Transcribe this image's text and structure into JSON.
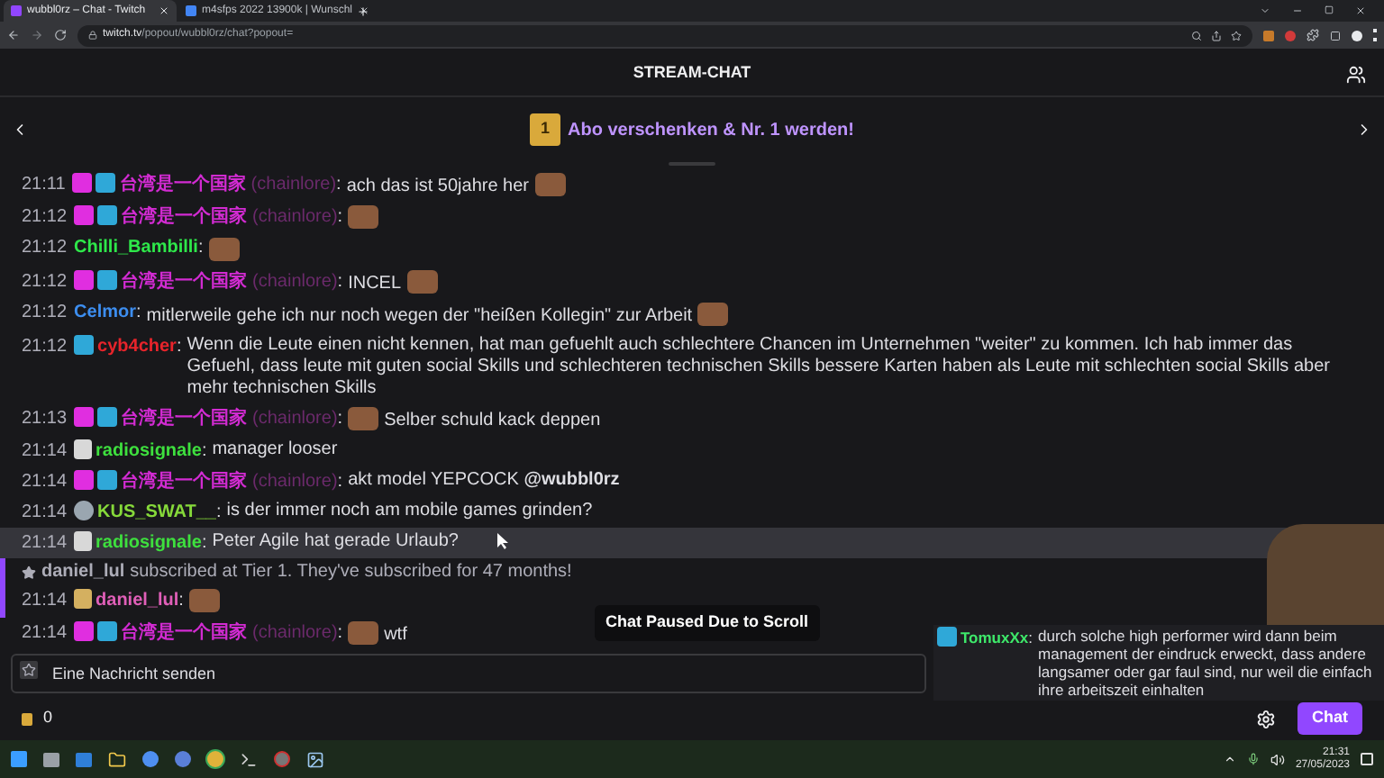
{
  "browser": {
    "tabs": [
      {
        "title": "wubbl0rz – Chat - Twitch",
        "selected": true
      },
      {
        "title": "m4sfps 2022 13900k | Wunschl",
        "selected": false
      }
    ],
    "url_host": "twitch.tv",
    "url_path": "/popout/wubbl0rz/chat?popout="
  },
  "header": {
    "title": "STREAM-CHAT"
  },
  "banner": {
    "text": "Abo verschenken & Nr. 1 werden!",
    "badge": "1"
  },
  "messages": [
    {
      "kind": "chat",
      "time": "21:11",
      "badges": [
        {
          "kind": "gem"
        },
        {
          "kind": "crown"
        }
      ],
      "user": "台湾是一个国家",
      "login": "(chainlore)",
      "separator": ":",
      "color": "#d22bd2",
      "hovered": false,
      "parts": [
        {
          "kind": "text",
          "text": "ach das ist 50jahre her"
        },
        {
          "kind": "emote"
        }
      ]
    },
    {
      "kind": "chat",
      "time": "21:12",
      "badges": [
        {
          "kind": "gem"
        },
        {
          "kind": "crown"
        }
      ],
      "user": "台湾是一个国家",
      "login": "(chainlore)",
      "separator": ":",
      "color": "#d22bd2",
      "hovered": false,
      "parts": [
        {
          "kind": "emote"
        }
      ]
    },
    {
      "kind": "chat",
      "time": "21:12",
      "user": "Chilli_Bambilli",
      "separator": ":",
      "color": "#2ee84a",
      "hovered": false,
      "parts": [
        {
          "kind": "emote"
        }
      ]
    },
    {
      "kind": "chat",
      "time": "21:12",
      "badges": [
        {
          "kind": "gem"
        },
        {
          "kind": "crown"
        }
      ],
      "user": "台湾是一个国家",
      "login": "(chainlore)",
      "separator": ":",
      "color": "#d22bd2",
      "hovered": false,
      "parts": [
        {
          "kind": "text",
          "text": "INCEL"
        },
        {
          "kind": "emote"
        }
      ]
    },
    {
      "kind": "chat",
      "time": "21:12",
      "user": "Celmor",
      "separator": ":",
      "color": "#3d8ef0",
      "hovered": false,
      "parts": [
        {
          "kind": "text",
          "text": "mitlerweile gehe ich nur noch wegen der \"heißen Kollegin\" zur Arbeit"
        },
        {
          "kind": "emote"
        }
      ]
    },
    {
      "kind": "chat",
      "time": "21:12",
      "badges": [
        {
          "kind": "crown"
        }
      ],
      "user": "cyb4cher",
      "separator": ":",
      "color": "#e8242b",
      "hovered": false,
      "parts": [
        {
          "kind": "text",
          "text": "Wenn die Leute einen nicht kennen, hat man gefuehlt auch schlechtere Chancen im Unternehmen \"weiter\" zu kommen. Ich hab immer das Gefuehl, dass leute mit guten social Skills und schlechteren technischen Skills bessere Karten haben als Leute mit schlechten social Skills aber mehr technischen Skills"
        }
      ]
    },
    {
      "kind": "chat",
      "time": "21:13",
      "badges": [
        {
          "kind": "gem"
        },
        {
          "kind": "crown"
        }
      ],
      "user": "台湾是一个国家",
      "login": "(chainlore)",
      "separator": ":",
      "color": "#d22bd2",
      "hovered": false,
      "parts": [
        {
          "kind": "emote"
        },
        {
          "kind": "text",
          "text": "Selber schuld kack deppen"
        }
      ]
    },
    {
      "kind": "chat",
      "time": "21:14",
      "badges": [
        {
          "kind": "avatar"
        }
      ],
      "user": "radiosignale",
      "separator": ":",
      "color": "#3ee03e",
      "hovered": false,
      "parts": [
        {
          "kind": "text",
          "text": "manager looser"
        }
      ]
    },
    {
      "kind": "chat",
      "time": "21:14",
      "badges": [
        {
          "kind": "gem"
        },
        {
          "kind": "crown"
        }
      ],
      "user": "台湾是一个国家",
      "login": "(chainlore)",
      "separator": ":",
      "color": "#d22bd2",
      "hovered": false,
      "parts": [
        {
          "kind": "text",
          "text": "akt model YEPCOCK **@wubbl0rz**"
        }
      ]
    },
    {
      "kind": "chat",
      "time": "21:14",
      "badges": [
        {
          "kind": "globe"
        }
      ],
      "user": "KUS_SWAT__",
      "separator": ":",
      "color": "#86d93a",
      "hovered": false,
      "parts": [
        {
          "kind": "text",
          "text": "is der immer noch am mobile games grinden?"
        }
      ]
    },
    {
      "kind": "chat",
      "time": "21:14",
      "badges": [
        {
          "kind": "avatar"
        }
      ],
      "user": "radiosignale",
      "separator": ":",
      "color": "#3ee03e",
      "hovered": true,
      "parts": [
        {
          "kind": "text",
          "text": "Peter Agile hat gerade Urlaub?"
        }
      ]
    },
    {
      "kind": "sub",
      "user": "daniel_lul",
      "text": "subscribed at Tier 1. They've subscribed for 47 months!",
      "message": {
        "time": "21:14",
        "badges": [
          {
            "kind": "tile"
          }
        ],
        "user": "daniel_lul",
        "separator": ":",
        "color": "#e05fb8",
        "parts": [
          {
            "kind": "emote"
          }
        ]
      }
    },
    {
      "kind": "chat",
      "time": "21:14",
      "badges": [
        {
          "kind": "gem"
        },
        {
          "kind": "crown"
        }
      ],
      "user": "台湾是一个国家",
      "login": "(chainlore)",
      "separator": ":",
      "color": "#d22bd2",
      "hovered": false,
      "parts": [
        {
          "kind": "emote"
        },
        {
          "kind": "text",
          "text": "wtf"
        }
      ]
    }
  ],
  "paused_notice": "Chat Paused Due to Scroll",
  "overlay_message": {
    "badges": [
      {
        "kind": "crown"
      }
    ],
    "user": "TomuxXx",
    "separator": ":",
    "color": "#3ee86a",
    "text": "durch solche high performer wird dann beim management der eindruck erweckt, dass andere langsamer oder gar faul sind, nur weil die einfach ihre arbeitszeit einhalten"
  },
  "input": {
    "placeholder": "Eine Nachricht senden"
  },
  "bits": {
    "count": "0"
  },
  "chat_button": "Chat",
  "taskbar": {
    "time": "21:31",
    "date": "27/05/2023"
  }
}
